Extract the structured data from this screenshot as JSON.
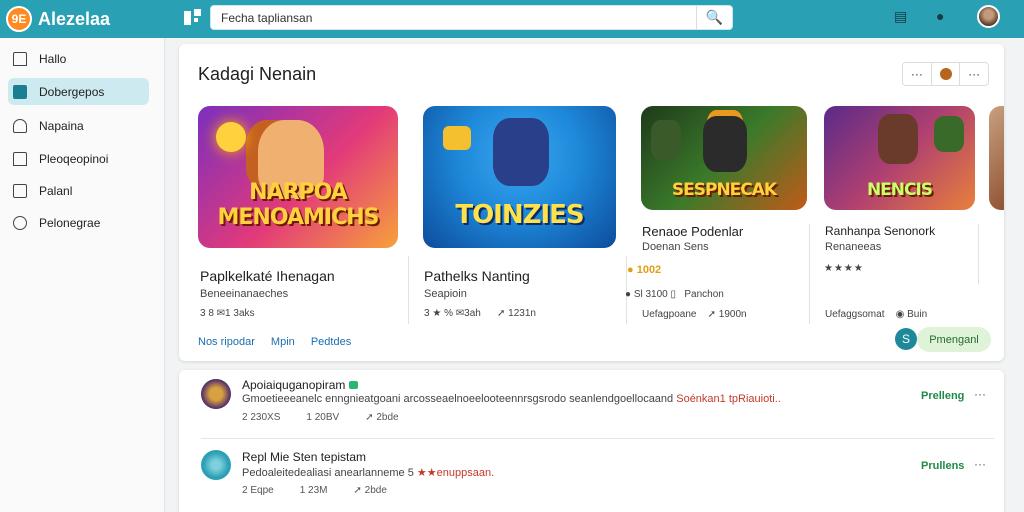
{
  "app": {
    "logo_badge": "9E",
    "name": "Alezelaa"
  },
  "search": {
    "value": "Fecha tapliansan"
  },
  "sidebar": {
    "items": [
      {
        "label": "Hallo",
        "icon": "home-icon",
        "active": false
      },
      {
        "label": "Dobergepos",
        "icon": "library-icon",
        "active": true
      },
      {
        "label": "Napaina",
        "icon": "bell-icon",
        "active": false
      },
      {
        "label": "Pleoqeopinoi",
        "icon": "house-icon",
        "active": false
      },
      {
        "label": "Palanl",
        "icon": "square-icon",
        "active": false
      },
      {
        "label": "Pelonegrae",
        "icon": "info-icon",
        "active": false
      }
    ]
  },
  "section": {
    "title": "Kadagi Nenain"
  },
  "games": [
    {
      "art_text": "NARPOA MENOAMICHS",
      "name": "Paplkelkaté Ihenagan",
      "sub": "Beneeinanaeches",
      "meta": "3  8  ✉1 3aks",
      "colors": [
        "#7b2fbf",
        "#e23a7a",
        "#f7a13b"
      ]
    },
    {
      "art_text": "TOINZIES",
      "name": "Pathelks Nanting",
      "sub": "Seapioin",
      "meta1": "3 ★ %  ✉3ah",
      "meta2": "1231n",
      "colors": [
        "#1e88d9",
        "#3aa8f0",
        "#0d4c9c"
      ]
    },
    {
      "art_text": "SESPNECAK",
      "name": "Renaoe Podenlar",
      "sub": "Doenan Sens",
      "rating": "1002",
      "meta1": "Sl 3100 ▯",
      "meta2": "Panchon",
      "meta3": "Uefagpoane",
      "meta4": "1900n",
      "colors": [
        "#1e3a1a",
        "#3b7a2a",
        "#c25a1a"
      ]
    },
    {
      "art_text": "NENCIS",
      "name": "Ranhanpa Senonork",
      "sub": "Renaneeas",
      "stars": "★★★★",
      "meta1": "Uefaggsomat",
      "meta2": "Buin",
      "colors": [
        "#5a2a8a",
        "#b04070",
        "#e8803a"
      ]
    }
  ],
  "links": [
    "Nos ripodar",
    "Mpin",
    "Pedtdes"
  ],
  "get_btn": {
    "icon": "S",
    "label": "Pmenganl"
  },
  "feed": [
    {
      "title": "Apoiaiquganopiram",
      "desc_a": "Gmoetieeeanelc enngnieatgoani  arcosseaelnoeelooteennrsgsrodo seanlendgoellocaand",
      "desc_b": "Soénkan1 tpRiauioti..",
      "meta": [
        "2 230XS",
        "1 20BV",
        "2bde"
      ],
      "action": "Prelleng",
      "colors": [
        "#4b2a6a",
        "#d8a040"
      ]
    },
    {
      "title": "Repl Mie Sten tepistam",
      "desc_a": "Pedoaleitedealiasi anearlanneme 5",
      "desc_b": "★★enuppsaan.",
      "meta": [
        "2 Eqpe",
        "1 23M",
        "2bde"
      ],
      "action": "Prullens",
      "colors": [
        "#2aa0b4",
        "#7fd0dc"
      ]
    }
  ]
}
